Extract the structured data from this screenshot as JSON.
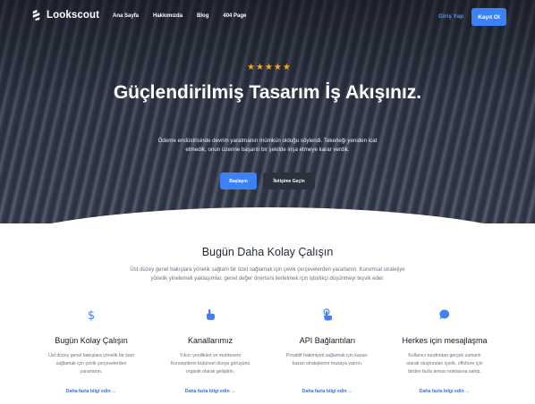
{
  "brand": {
    "name": "Lookscout"
  },
  "nav": {
    "items": [
      "Ana Sayfa",
      "Hakkımızda",
      "Blog",
      "404 Page"
    ],
    "login_label": "Giriş Yap",
    "signup_label": "Kayıt Ol"
  },
  "hero": {
    "rating_stars": 5,
    "title": "Güçlendirilmiş Tasarım İş Akışınız.",
    "subtitle": "Ödeme endüstrisinde devrim yaratmanın mümkün olduğu söylendi. Tekerleği yeniden icat etmedik, onun üzerine başarılı bir şekilde inşa etmeye karar verdik.",
    "primary_button": "Başlayın",
    "secondary_button": "İletişime Geçin"
  },
  "section": {
    "title": "Bugün Daha Kolay Çalışın",
    "subtitle": "Üst düzey genel bakışlara yönelik sağlam bir özet sağlamak için çevik çerçevelerden yararlanın. Kurumsal stratejiye yönelik yinelemeli yaklaşımlar, genel değer önerisini ilerletmek için işbirlikçi düşünmeyi teşvik eder."
  },
  "features": [
    {
      "icon": "dollar-icon",
      "title": "Bugün Kolay Çalışın",
      "desc": "Üst düzey genel bakışlara yönelik bir özet sağlamak için çevik çerçevelerden yararlanın.",
      "link": "Daha fazla bilgi edin →"
    },
    {
      "icon": "hand-pointer-icon",
      "title": "Kanallarımız",
      "desc": "Yıkıcı yenilikleri ve muhtesem Konseptlerin bütünsel dünya görüşünü organik olarak geliştirin.",
      "link": "Daha fazla bilgi edin →"
    },
    {
      "icon": "touch-icon",
      "title": "API Bağlantıları",
      "desc": "Proaktif hakimiyeti sağlamak için kazan-kazan stratejilerini masaya yatırın.",
      "link": "Daha fazla bilgi edin →"
    },
    {
      "icon": "chat-bubble-icon",
      "title": "Herkes için mesajlaşma",
      "desc": "Kullanıcı tarafından gerçek zamanlı olarak oluşturulan içerik, offshore için birden fazla temas noktasına sahip.",
      "link": "Daha fazla bilgi edin →"
    }
  ],
  "colors": {
    "accent": "#3b82f6",
    "star": "#f5a623",
    "link": "#3b6fd8"
  }
}
